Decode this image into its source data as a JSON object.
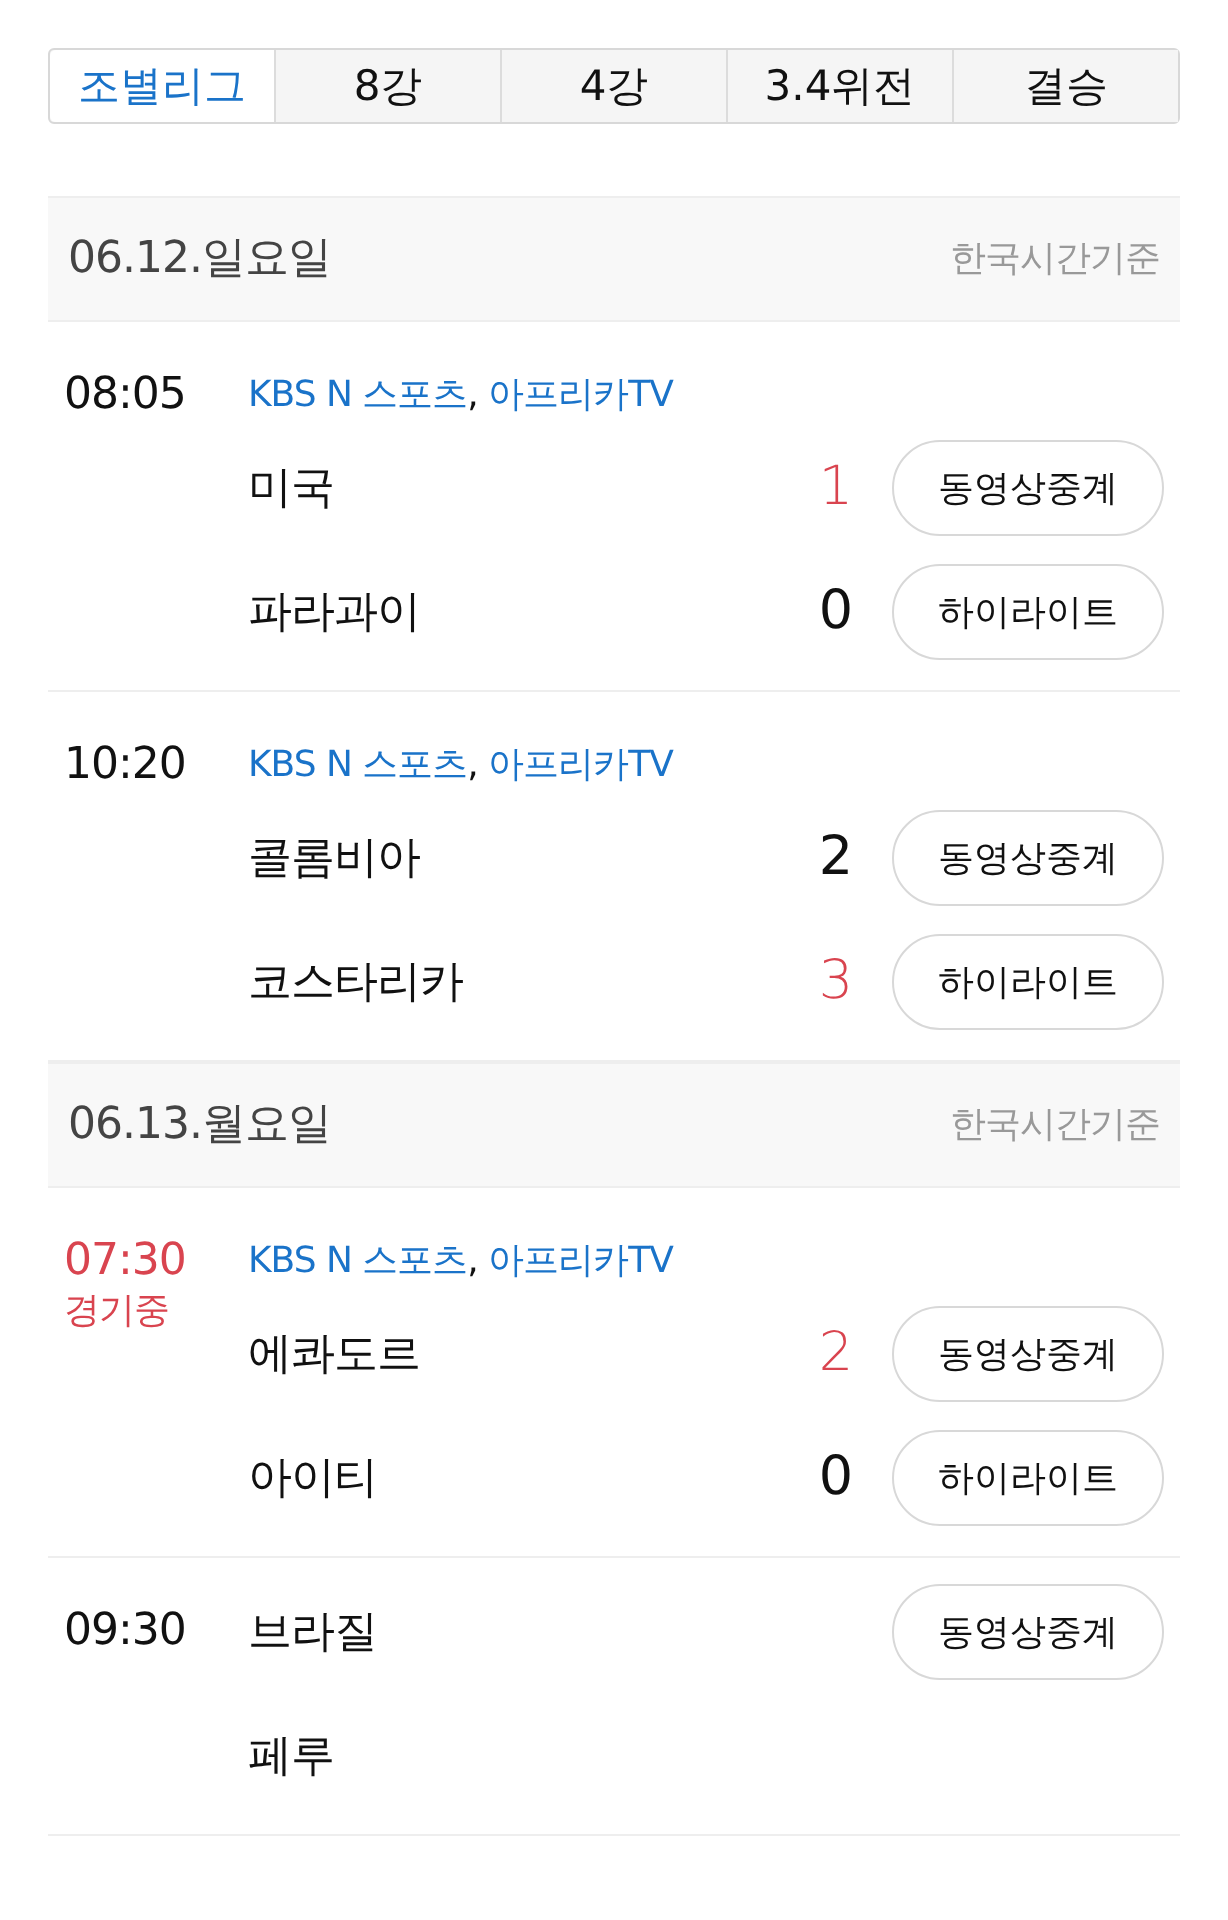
{
  "tabs": [
    {
      "label": "조별리그",
      "selected": true
    },
    {
      "label": "8강",
      "selected": false
    },
    {
      "label": "4강",
      "selected": false
    },
    {
      "label": "3.4위전",
      "selected": false
    },
    {
      "label": "결승",
      "selected": false
    }
  ],
  "days": [
    {
      "date": "06.12.일요일",
      "note": "한국시간기준",
      "matches": [
        {
          "time": "08:05",
          "live": false,
          "channels": [
            {
              "label": "KBS N 스포츠",
              "separator": ","
            },
            {
              "label": "아프리카TV"
            }
          ],
          "teams": [
            {
              "name": "미국",
              "score": "1",
              "leading": true,
              "button": "동영상중계"
            },
            {
              "name": "파라과이",
              "score": "0",
              "leading": false,
              "button": "하이라이트"
            }
          ]
        },
        {
          "time": "10:20",
          "live": false,
          "channels": [
            {
              "label": "KBS N 스포츠",
              "separator": ","
            },
            {
              "label": "아프리카TV"
            }
          ],
          "teams": [
            {
              "name": "콜롬비아",
              "score": "2",
              "leading": false,
              "button": "동영상중계"
            },
            {
              "name": "코스타리카",
              "score": "3",
              "leading": true,
              "button": "하이라이트"
            }
          ]
        }
      ]
    },
    {
      "date": "06.13.월요일",
      "note": "한국시간기준",
      "matches": [
        {
          "time": "07:30",
          "live": true,
          "status": "경기중",
          "channels": [
            {
              "label": "KBS N 스포츠",
              "separator": ","
            },
            {
              "label": "아프리카TV"
            }
          ],
          "teams": [
            {
              "name": "에콰도르",
              "score": "2",
              "leading": true,
              "button": "동영상중계"
            },
            {
              "name": "아이티",
              "score": "0",
              "leading": false,
              "button": "하이라이트"
            }
          ]
        },
        {
          "time": "09:30",
          "live": false,
          "teams": [
            {
              "name": "브라질",
              "button": "동영상중계"
            },
            {
              "name": "페루"
            }
          ]
        }
      ]
    }
  ]
}
